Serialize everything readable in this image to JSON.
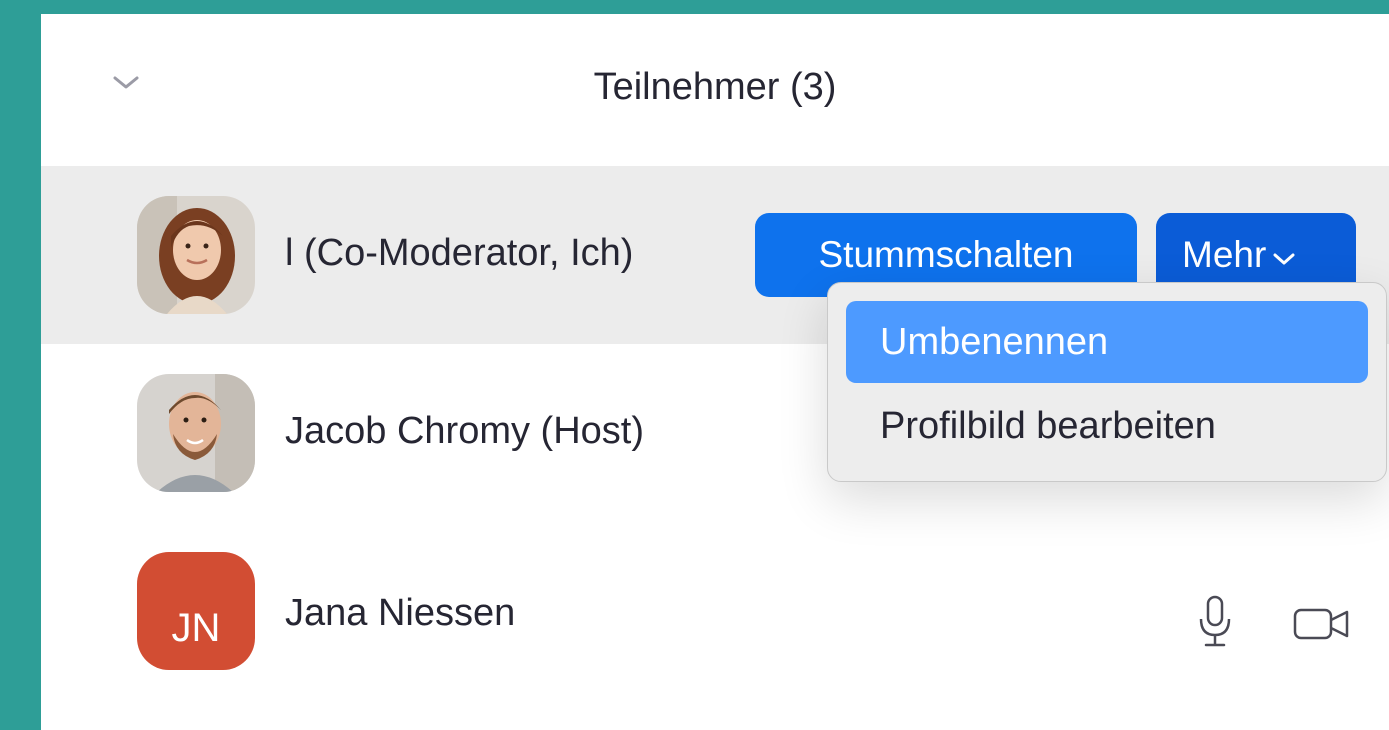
{
  "header": {
    "title": "Teilnehmer (3)"
  },
  "participants": [
    {
      "name": "l (Co-Moderator, Ich)",
      "avatar": "photo-woman"
    },
    {
      "name": "Jacob Chromy (Host)",
      "avatar": "photo-man"
    },
    {
      "name": "Jana Niessen",
      "initials": "JN",
      "avatar_color": "#d24d33"
    }
  ],
  "actions": {
    "mute_label": "Stummschalten",
    "more_label": "Mehr"
  },
  "more_menu": {
    "items": [
      "Umbenennen",
      "Profilbild bearbeiten"
    ],
    "highlighted": "Umbenennen"
  },
  "colors": {
    "background": "#2e9e97",
    "mute_button": "#0e72ed",
    "more_button": "#0b5cd7",
    "menu_highlight": "#4d9aff",
    "selected_row": "#ececec"
  },
  "icons": [
    "chevron-down-icon",
    "microphone-icon",
    "video-camera-icon"
  ]
}
